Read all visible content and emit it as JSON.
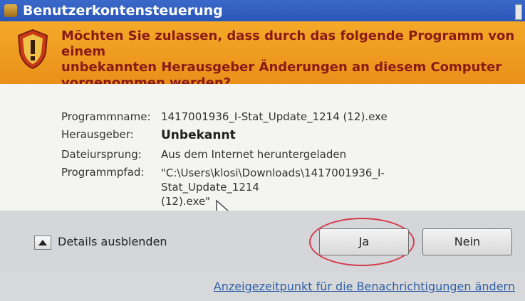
{
  "window": {
    "title": "Benutzerkontensteuerung"
  },
  "warning": {
    "message": "Möchten Sie zulassen, dass durch das folgende Programm von einem\nunbekannten Herausgeber Änderungen an diesem Computer\nvorgenommen werden?"
  },
  "details": {
    "program_name_label": "Programmname:",
    "program_name": "1417001936_I-Stat_Update_1214 (12).exe",
    "publisher_label": "Herausgeber:",
    "publisher": "Unbekannt",
    "origin_label": "Dateiursprung:",
    "origin": "Aus dem Internet heruntergeladen",
    "path_label": "Programmpfad:",
    "path": "\"C:\\Users\\klosi\\Downloads\\1417001936_I-Stat_Update_1214\n(12).exe\""
  },
  "actions": {
    "toggle_details": "Details ausblenden",
    "yes": "Ja",
    "no": "Nein"
  },
  "footer": {
    "link": "Anzeigezeitpunkt für die Benachrichtigungen ändern"
  },
  "colors": {
    "title_bar": "#2f5fc3",
    "warning_band": "#f0a024",
    "warning_text": "#8a1a16",
    "highlight_circle": "#d63a4a"
  }
}
